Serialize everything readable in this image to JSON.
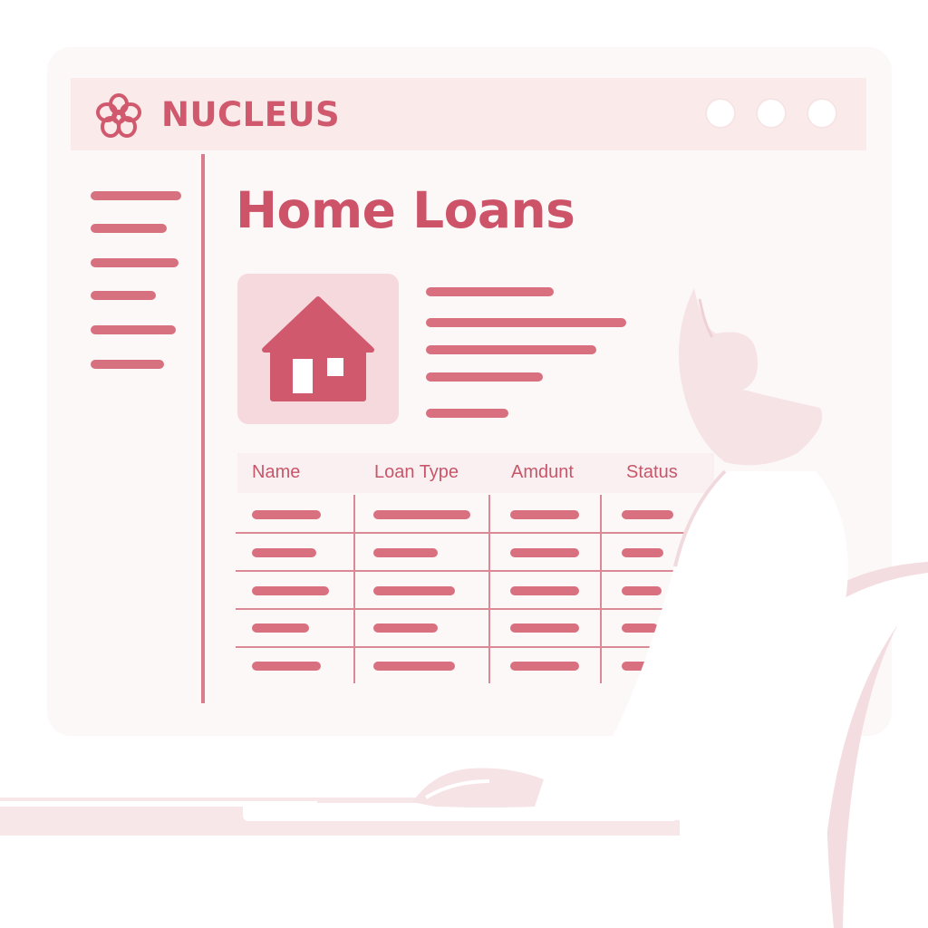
{
  "app": {
    "brand_name": "NUCLEUS",
    "logo_icon": "flower-logo-icon",
    "window_buttons": [
      "window-dot-1",
      "window-dot-2",
      "window-dot-3"
    ]
  },
  "sidebar": {
    "item_count": 6
  },
  "main": {
    "title": "Home Loans",
    "hero_icon": "house-icon"
  },
  "table": {
    "columns": [
      "Name",
      "Loan Type",
      "Amdunt",
      "Status"
    ],
    "row_count": 5
  },
  "colors": {
    "accent": "#d0596e",
    "accent_light": "#f6d9dd",
    "line": "#d9707f",
    "background": "#ffffff"
  }
}
